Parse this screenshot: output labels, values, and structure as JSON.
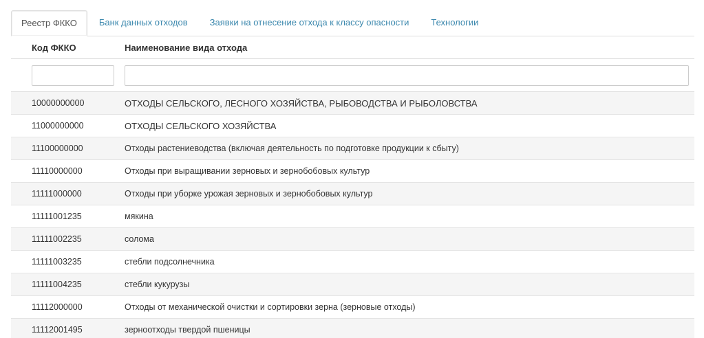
{
  "tabs": [
    {
      "label": "Реестр ФККО",
      "active": true
    },
    {
      "label": "Банк данных отходов",
      "active": false
    },
    {
      "label": "Заявки на отнесение отхода к классу опасности",
      "active": false
    },
    {
      "label": "Технологии",
      "active": false
    }
  ],
  "table": {
    "headers": {
      "code": "Код ФККО",
      "name": "Наименование вида отхода"
    },
    "filters": {
      "code_value": "",
      "name_value": ""
    },
    "rows": [
      {
        "code": "10000000000",
        "name": "ОТХОДЫ СЕЛЬСКОГО, ЛЕСНОГО ХОЗЯЙСТВА, РЫБОВОДСТВА И РЫБОЛОВСТВА"
      },
      {
        "code": "11000000000",
        "name": "ОТХОДЫ СЕЛЬСКОГО ХОЗЯЙСТВА"
      },
      {
        "code": "11100000000",
        "name": "Отходы растениеводства (включая деятельность по подготовке продукции к сбыту)"
      },
      {
        "code": "11110000000",
        "name": "Отходы при выращивании зерновых и зернобобовых культур"
      },
      {
        "code": "11111000000",
        "name": "Отходы при уборке урожая зерновых и зернобобовых культур"
      },
      {
        "code": "11111001235",
        "name": "мякина"
      },
      {
        "code": "11111002235",
        "name": "солома"
      },
      {
        "code": "11111003235",
        "name": "стебли подсолнечника"
      },
      {
        "code": "11111004235",
        "name": "стебли кукурузы"
      },
      {
        "code": "11112000000",
        "name": "Отходы от механической очистки и сортировки зерна (зерновые отходы)"
      },
      {
        "code": "11112001495",
        "name": "зерноотходы твердой пшеницы"
      }
    ]
  }
}
